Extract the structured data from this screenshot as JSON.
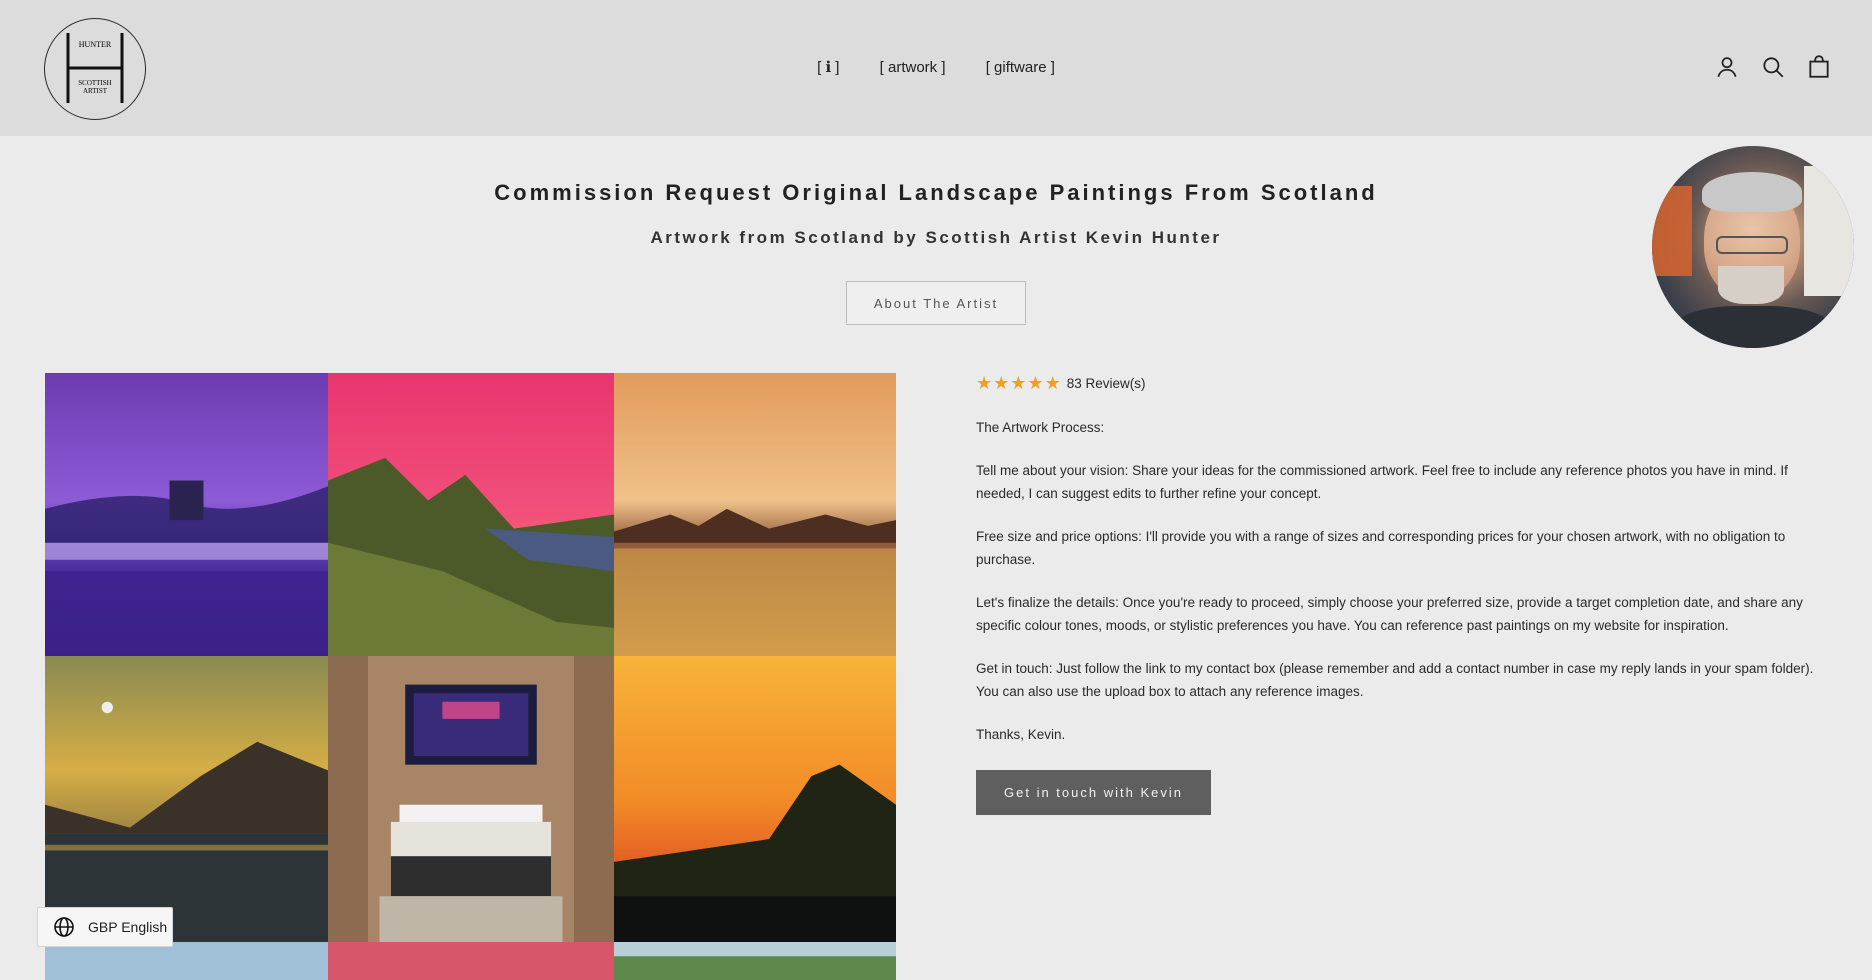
{
  "header": {
    "logo": {
      "line1": "HUNTER",
      "line2": "SCOTTISH",
      "line3": "ARTIST"
    },
    "nav": [
      {
        "label": "[ ℹ ]"
      },
      {
        "label": "[ artwork ]"
      },
      {
        "label": "[ giftware ]"
      }
    ],
    "icons": [
      "account-icon",
      "search-icon",
      "cart-icon"
    ]
  },
  "hero": {
    "title": "Commission Request Original Landscape Paintings From Scotland",
    "subtitle": "Artwork from Scotland by Scottish Artist Kevin Hunter",
    "about_button": "About The Artist"
  },
  "reviews": {
    "rating": 5,
    "label": "83 Review(s)"
  },
  "content": {
    "intro": "The Artwork Process:",
    "p1": "Tell me about your vision: Share your ideas for the commissioned artwork. Feel free to include any reference photos you have in mind. If needed, I can suggest edits to further refine your concept.",
    "p2": "Free size and price options: I'll provide you with a range of sizes and corresponding prices for your chosen artwork, with no obligation to purchase.",
    "p3": "Let's finalize the details:  Once you're ready to proceed, simply choose your preferred size, provide a target completion date, and share any specific colour tones, moods, or stylistic preferences you have. You can reference past paintings on my website for inspiration.",
    "p4": "Get in touch:  Just follow the link to my contact box (please remember and add a contact number in case my reply lands in your spam folder). You can also use the upload box to attach any reference images.",
    "signoff": "Thanks, Kevin.",
    "cta": "Get in touch with Kevin"
  },
  "currency": {
    "label": "GBP English"
  },
  "colors": {
    "star": "#f0a020",
    "cta_bg": "#5f5f5f",
    "header_bg": "#dcdcdc",
    "page_bg": "#ebebeb"
  }
}
